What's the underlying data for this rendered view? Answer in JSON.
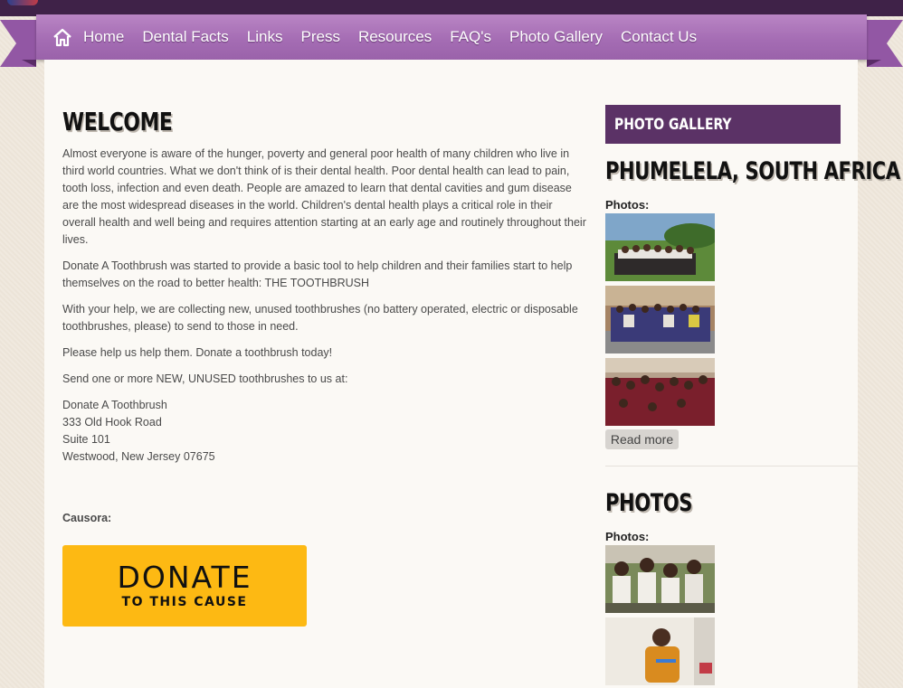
{
  "nav": {
    "home_icon": "home-icon",
    "items": [
      "Home",
      "Dental Facts",
      "Links",
      "Press",
      "Resources",
      "FAQ's",
      "Photo Gallery",
      "Contact Us"
    ]
  },
  "main": {
    "heading": "WELCOME",
    "paragraphs": [
      "Almost everyone is aware of the hunger, poverty and general poor health of many children who live in third world countries. What we don't think of is their dental health. Poor dental health can lead to pain, tooth loss, infection and even death. People are amazed to learn that dental cavities and gum disease are the most widespread diseases in the world. Children's dental health plays a critical role in their overall health and well being and requires attention starting at an early age and routinely throughout their lives.",
      "Donate A Toothbrush was started to provide a basic tool to help children and their families start to help themselves on the road to better health: THE TOOTHBRUSH",
      "With your help, we are collecting new, unused toothbrushes (no battery operated, electric or disposable toothbrushes, please) to send to those in need.",
      "Please help us help them. Donate a toothbrush today!",
      "Send one or more NEW, UNUSED toothbrushes to us at:"
    ],
    "address": [
      "Donate A Toothbrush",
      "333 Old Hook Road",
      "Suite 101",
      "Westwood, New Jersey 07675"
    ],
    "causora_label": "Causora:",
    "donate": {
      "big": "DONATE",
      "small": "TO THIS CAUSE",
      "color": "#fdb913"
    }
  },
  "sidebar": {
    "widget_title": "PHOTO GALLERY",
    "gallery1": {
      "title": "PHUMELELA, SOUTH AFRICA",
      "photos_label": "Photos:",
      "read_more": "Read more"
    },
    "gallery2": {
      "title": "PHOTOS",
      "photos_label": "Photos:"
    }
  },
  "colors": {
    "nav": "#a56db4",
    "widget_title_bg": "#5b3266",
    "topbar": "#3f2248"
  }
}
